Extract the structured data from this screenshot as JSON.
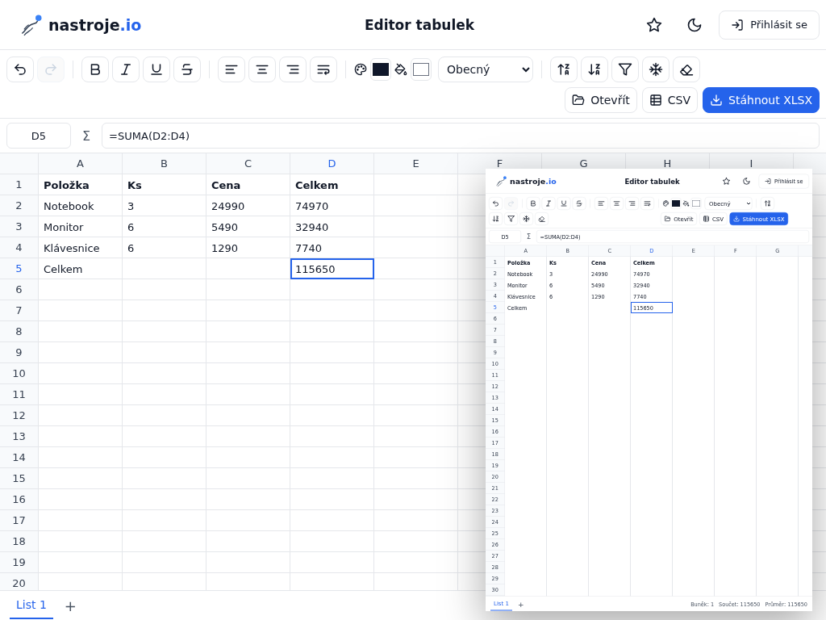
{
  "main": {
    "header": {
      "logo_name": "nastroje",
      "logo_suffix": ".io",
      "title": "Editor tabulek",
      "login_button": "Přihlásit se"
    },
    "toolbar": {
      "history": [
        {
          "kind": "undo",
          "disabled": false
        },
        {
          "kind": "redo",
          "disabled": true
        }
      ],
      "number_format": "Obecný",
      "actions": [
        {
          "kind": "open",
          "label": "Otevřít"
        },
        {
          "kind": "csv",
          "label": "CSV"
        },
        {
          "kind": "download",
          "label": "Stáhnout XLSX"
        }
      ]
    },
    "formula_bar": {
      "cell_ref": "D5",
      "sigma": "Σ",
      "formula": "=SUMA(D2:D4)"
    },
    "grid": {
      "columns": [
        {
          "label": "A",
          "selected": false
        },
        {
          "label": "B",
          "selected": false
        },
        {
          "label": "C",
          "selected": false
        },
        {
          "label": "D",
          "selected": true
        },
        {
          "label": "E",
          "selected": false
        },
        {
          "label": "F",
          "selected": false
        },
        {
          "label": "G",
          "selected": false
        },
        {
          "label": "H",
          "selected": false
        },
        {
          "label": "I",
          "selected": false
        }
      ],
      "rows": [
        {
          "label": "1",
          "selected": false,
          "kind": "header",
          "cells": [
            "Položka",
            "Ks",
            "Cena",
            "Celkem"
          ]
        },
        {
          "label": "2",
          "selected": false,
          "kind": "data",
          "cells": [
            "Notebook",
            "3",
            "24990",
            "74970"
          ]
        },
        {
          "label": "3",
          "selected": false,
          "kind": "data",
          "cells": [
            "Monitor",
            "6",
            "5490",
            "32940"
          ]
        },
        {
          "label": "4",
          "selected": false,
          "kind": "data",
          "cells": [
            "Klávesnice",
            "6",
            "1290",
            "7740"
          ]
        },
        {
          "label": "5",
          "selected": true,
          "kind": "data",
          "cells": [
            "Celkem",
            "",
            "",
            "115650"
          ]
        },
        {
          "label": "6",
          "selected": false
        },
        {
          "label": "7",
          "selected": false
        },
        {
          "label": "8",
          "selected": false
        },
        {
          "label": "9",
          "selected": false
        },
        {
          "label": "10",
          "selected": false
        },
        {
          "label": "11",
          "selected": false
        },
        {
          "label": "12",
          "selected": false
        },
        {
          "label": "13",
          "selected": false
        },
        {
          "label": "14",
          "selected": false
        },
        {
          "label": "15",
          "selected": false
        },
        {
          "label": "16",
          "selected": false
        },
        {
          "label": "17",
          "selected": false
        },
        {
          "label": "18",
          "selected": false
        },
        {
          "label": "19",
          "selected": false
        },
        {
          "label": "20",
          "selected": false
        }
      ]
    },
    "sheet_tabs": [
      {
        "label": "List 1",
        "selected": true
      }
    ],
    "add_sheet": "+"
  },
  "preview": {
    "header": {
      "logo_name": "nastroje",
      "logo_suffix": ".io",
      "title": "Editor tabulek",
      "login_button": "Přihlásit se"
    },
    "toolbar": {
      "history": [
        {
          "kind": "undo",
          "disabled": false
        },
        {
          "kind": "redo",
          "disabled": true
        }
      ],
      "number_format": "Obecný",
      "actions": [
        {
          "kind": "open",
          "label": "Otevřít"
        },
        {
          "kind": "csv",
          "label": "CSV"
        },
        {
          "kind": "download",
          "label": "Stáhnout XLSX"
        }
      ]
    },
    "formula_bar": {
      "cell_ref": "D5",
      "sigma": "Σ",
      "formula": "=SUMA(D2:D4)"
    },
    "grid": {
      "columns": [
        {
          "label": "A",
          "selected": false
        },
        {
          "label": "B",
          "selected": false
        },
        {
          "label": "C",
          "selected": false
        },
        {
          "label": "D",
          "selected": true
        },
        {
          "label": "E",
          "selected": false
        },
        {
          "label": "F",
          "selected": false
        },
        {
          "label": "G",
          "selected": false
        }
      ],
      "rows": [
        {
          "label": "1",
          "selected": false,
          "kind": "header",
          "cells": [
            "Položka",
            "Ks",
            "Cena",
            "Celkem"
          ]
        },
        {
          "label": "2",
          "selected": false,
          "kind": "data",
          "cells": [
            "Notebook",
            "3",
            "24990",
            "74970"
          ]
        },
        {
          "label": "3",
          "selected": false,
          "kind": "data",
          "cells": [
            "Monitor",
            "6",
            "5490",
            "32940"
          ]
        },
        {
          "label": "4",
          "selected": false,
          "kind": "data",
          "cells": [
            "Klávesnice",
            "6",
            "1290",
            "7740"
          ]
        },
        {
          "label": "5",
          "selected": true,
          "kind": "data",
          "cells": [
            "Celkem",
            "",
            "",
            "115650"
          ]
        },
        {
          "label": "6",
          "selected": false
        },
        {
          "label": "7",
          "selected": false
        },
        {
          "label": "8",
          "selected": false
        },
        {
          "label": "9",
          "selected": false
        },
        {
          "label": "10",
          "selected": false
        },
        {
          "label": "11",
          "selected": false
        },
        {
          "label": "12",
          "selected": false
        },
        {
          "label": "13",
          "selected": false
        },
        {
          "label": "14",
          "selected": false
        },
        {
          "label": "15",
          "selected": false
        },
        {
          "label": "16",
          "selected": false
        },
        {
          "label": "17",
          "selected": false
        },
        {
          "label": "18",
          "selected": false
        },
        {
          "label": "19",
          "selected": false
        },
        {
          "label": "20",
          "selected": false
        },
        {
          "label": "21",
          "selected": false
        },
        {
          "label": "22",
          "selected": false
        },
        {
          "label": "23",
          "selected": false
        },
        {
          "label": "24",
          "selected": false
        },
        {
          "label": "25",
          "selected": false
        },
        {
          "label": "26",
          "selected": false
        },
        {
          "label": "27",
          "selected": false
        },
        {
          "label": "28",
          "selected": false
        },
        {
          "label": "29",
          "selected": false
        },
        {
          "label": "30",
          "selected": false
        }
      ]
    },
    "sheet_tabs": [
      {
        "label": "List 1",
        "selected": true
      }
    ],
    "add_sheet": "+",
    "status": [
      "Buněk: 1",
      "Součet: 115650",
      "Průměr: 115650"
    ]
  }
}
